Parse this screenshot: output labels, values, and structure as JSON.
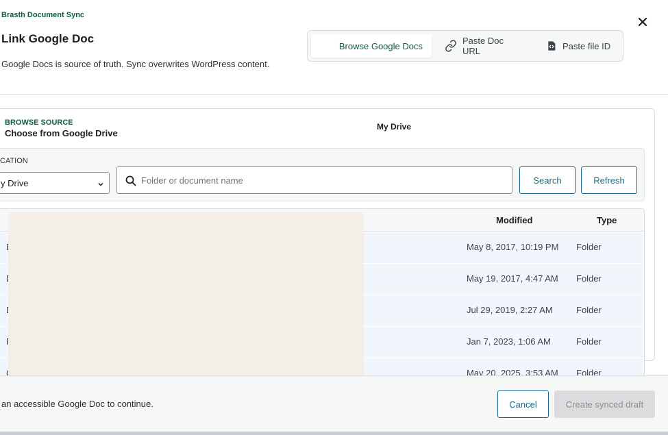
{
  "app_label": "Brasth Document Sync",
  "dialog": {
    "title": "Link Google Doc",
    "description": "Google Docs is source of truth. Sync overwrites WordPress content.",
    "close_icon": "close-icon"
  },
  "mode_tabs": [
    {
      "label": "Browse Google Docs",
      "active": true
    },
    {
      "label": "Paste Doc URL",
      "icon": "link-icon",
      "active": false
    },
    {
      "label": "Paste file ID",
      "icon": "code-file-icon",
      "active": false
    }
  ],
  "browse": {
    "section_label": "BROWSE SOURCE",
    "section_title": "Choose from Google Drive",
    "drive_name": "My Drive",
    "location_label": "CATION",
    "location_value": "y Drive",
    "search_placeholder": "Folder or document name",
    "search_button": "Search",
    "refresh_button": "Refresh"
  },
  "table": {
    "columns": [
      "Modified",
      "Type"
    ],
    "rows": [
      {
        "name": "E",
        "modified": "May 8, 2017, 10:19 PM",
        "type": "Folder"
      },
      {
        "name": "D",
        "modified": "May 19, 2017, 4:47 AM",
        "type": "Folder"
      },
      {
        "name": "D",
        "modified": "Jul 29, 2019, 2:27 AM",
        "type": "Folder"
      },
      {
        "name": "F",
        "modified": "Jan 7, 2023, 1:06 AM",
        "type": "Folder"
      },
      {
        "name": "C",
        "modified": "May 20, 2025, 3:53 AM",
        "type": "Folder"
      }
    ]
  },
  "footer": {
    "hint": "an accessible Google Doc to continue.",
    "cancel_button": "Cancel",
    "create_button": "Create synced draft"
  },
  "colors": {
    "accent_green": "#0f5f3c",
    "button_blue": "#1b6a8f",
    "row_highlight": "#f0f6fc"
  }
}
